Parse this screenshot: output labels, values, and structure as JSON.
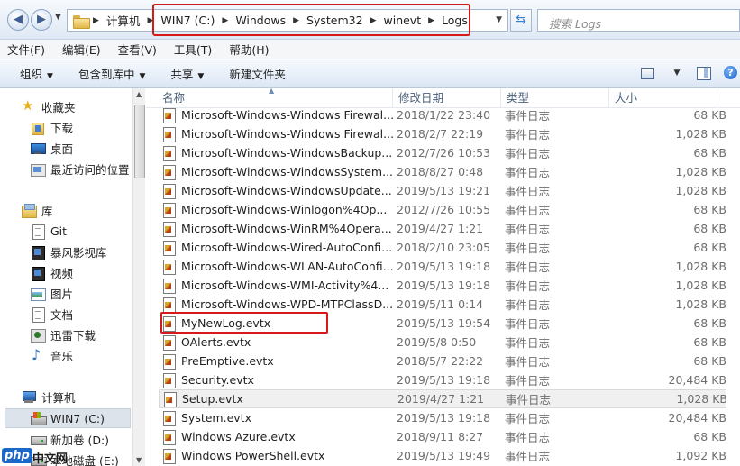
{
  "address": {
    "crumbs": [
      "计算机",
      "WIN7 (C:)",
      "Windows",
      "System32",
      "winevt",
      "Logs"
    ],
    "search_placeholder": "搜索 Logs"
  },
  "menu": [
    "文件(F)",
    "编辑(E)",
    "查看(V)",
    "工具(T)",
    "帮助(H)"
  ],
  "toolbar": {
    "organize": "组织",
    "include_library": "包含到库中",
    "share": "共享",
    "new_folder": "新建文件夹"
  },
  "nav": {
    "favorites": "收藏夹",
    "downloads": "下载",
    "desktop": "桌面",
    "recent": "最近访问的位置",
    "libraries": "库",
    "git": "Git",
    "storm_video": "暴风影视库",
    "videos": "视频",
    "pictures": "图片",
    "documents": "文档",
    "xunlei": "迅雷下载",
    "music": "音乐",
    "computer": "计算机",
    "win7": "WIN7 (C:)",
    "new_volume": "新加卷 (D:)",
    "local_disk": "本地磁盘 (E:)"
  },
  "columns": {
    "name": "名称",
    "date": "修改日期",
    "type": "类型",
    "size": "大小"
  },
  "files": [
    {
      "name": "Microsoft-Windows-Windows Firewal...",
      "date": "2018/1/22 23:40",
      "type": "事件日志",
      "size": "68 KB"
    },
    {
      "name": "Microsoft-Windows-Windows Firewal...",
      "date": "2018/2/7 22:19",
      "type": "事件日志",
      "size": "1,028 KB"
    },
    {
      "name": "Microsoft-Windows-WindowsBackup...",
      "date": "2012/7/26 10:53",
      "type": "事件日志",
      "size": "68 KB"
    },
    {
      "name": "Microsoft-Windows-WindowsSystem...",
      "date": "2018/8/27 0:48",
      "type": "事件日志",
      "size": "1,028 KB"
    },
    {
      "name": "Microsoft-Windows-WindowsUpdate...",
      "date": "2019/5/13 19:21",
      "type": "事件日志",
      "size": "1,028 KB"
    },
    {
      "name": "Microsoft-Windows-Winlogon%4Op...",
      "date": "2012/7/26 10:55",
      "type": "事件日志",
      "size": "68 KB"
    },
    {
      "name": "Microsoft-Windows-WinRM%4Opera...",
      "date": "2019/4/27 1:21",
      "type": "事件日志",
      "size": "68 KB"
    },
    {
      "name": "Microsoft-Windows-Wired-AutoConfi...",
      "date": "2018/2/10 23:05",
      "type": "事件日志",
      "size": "68 KB"
    },
    {
      "name": "Microsoft-Windows-WLAN-AutoConfi...",
      "date": "2019/5/13 19:18",
      "type": "事件日志",
      "size": "1,028 KB"
    },
    {
      "name": "Microsoft-Windows-WMI-Activity%4...",
      "date": "2019/5/13 19:18",
      "type": "事件日志",
      "size": "1,028 KB"
    },
    {
      "name": "Microsoft-Windows-WPD-MTPClassD...",
      "date": "2019/5/11 0:14",
      "type": "事件日志",
      "size": "1,028 KB"
    },
    {
      "name": "MyNewLog.evtx",
      "date": "2019/5/13 19:54",
      "type": "事件日志",
      "size": "68 KB"
    },
    {
      "name": "OAlerts.evtx",
      "date": "2019/5/8 0:50",
      "type": "事件日志",
      "size": "68 KB"
    },
    {
      "name": "PreEmptive.evtx",
      "date": "2018/5/7 22:22",
      "type": "事件日志",
      "size": "68 KB"
    },
    {
      "name": "Security.evtx",
      "date": "2019/5/13 19:18",
      "type": "事件日志",
      "size": "20,484 KB"
    },
    {
      "name": "Setup.evtx",
      "date": "2019/4/27 1:21",
      "type": "事件日志",
      "size": "1,028 KB"
    },
    {
      "name": "System.evtx",
      "date": "2019/5/13 19:18",
      "type": "事件日志",
      "size": "20,484 KB"
    },
    {
      "name": "Windows Azure.evtx",
      "date": "2018/9/11 8:27",
      "type": "事件日志",
      "size": "68 KB"
    },
    {
      "name": "Windows PowerShell.evtx",
      "date": "2019/5/13 19:49",
      "type": "事件日志",
      "size": "1,092 KB"
    }
  ],
  "watermark": {
    "logo": "php",
    "text": "中文网"
  }
}
